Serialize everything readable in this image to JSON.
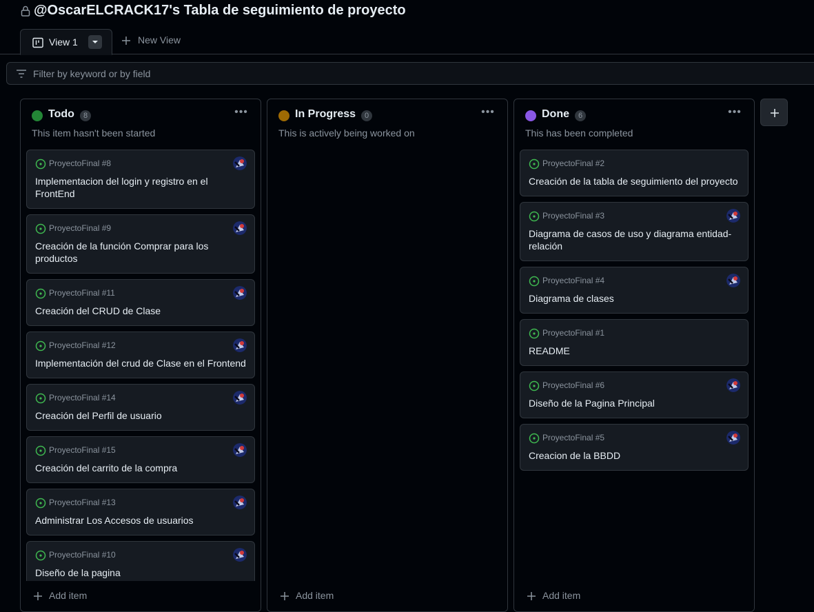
{
  "header": {
    "title": "@OscarELCRACK17's Tabla de seguimiento de proyecto",
    "lock_icon": "lock-icon"
  },
  "tabs": {
    "view1_label": "View 1",
    "new_view_label": "New View"
  },
  "filter": {
    "placeholder": "Filter by keyword or by field"
  },
  "colors": {
    "todo": "#238636",
    "in_progress": "#9e6a03",
    "done": "#8957e5",
    "open_issue": "#3fb950"
  },
  "columns": [
    {
      "title": "Todo",
      "count": "8",
      "description": "This item hasn't been started",
      "add_label": "Add item",
      "cards": [
        {
          "ref": "ProyectoFinal #8",
          "title": "Implementacion del login y registro en el FrontEnd"
        },
        {
          "ref": "ProyectoFinal #9",
          "title": "Creación de la función Comprar para los productos"
        },
        {
          "ref": "ProyectoFinal #11",
          "title": "Creación del CRUD de Clase"
        },
        {
          "ref": "ProyectoFinal #12",
          "title": "Implementación del crud de Clase en el Frontend"
        },
        {
          "ref": "ProyectoFinal #14",
          "title": "Creación del Perfil de usuario"
        },
        {
          "ref": "ProyectoFinal #15",
          "title": "Creación del carrito de la compra"
        },
        {
          "ref": "ProyectoFinal #13",
          "title": "Administrar Los Accesos de usuarios"
        },
        {
          "ref": "ProyectoFinal #10",
          "title": "Diseño de la pagina"
        }
      ]
    },
    {
      "title": "In Progress",
      "count": "0",
      "description": "This is actively being worked on",
      "add_label": "Add item",
      "cards": []
    },
    {
      "title": "Done",
      "count": "6",
      "description": "This has been completed",
      "add_label": "Add item",
      "cards": [
        {
          "ref": "ProyectoFinal #2",
          "title": "Creación de la tabla de seguimiento del proyecto"
        },
        {
          "ref": "ProyectoFinal #3",
          "title": "Diagrama de casos de uso y diagrama entidad-relación"
        },
        {
          "ref": "ProyectoFinal #4",
          "title": "Diagrama de clases"
        },
        {
          "ref": "ProyectoFinal #1",
          "title": "README"
        },
        {
          "ref": "ProyectoFinal #6",
          "title": "Diseño de la Pagina Principal"
        },
        {
          "ref": "ProyectoFinal #5",
          "title": "Creacion de la BBDD"
        }
      ]
    }
  ]
}
